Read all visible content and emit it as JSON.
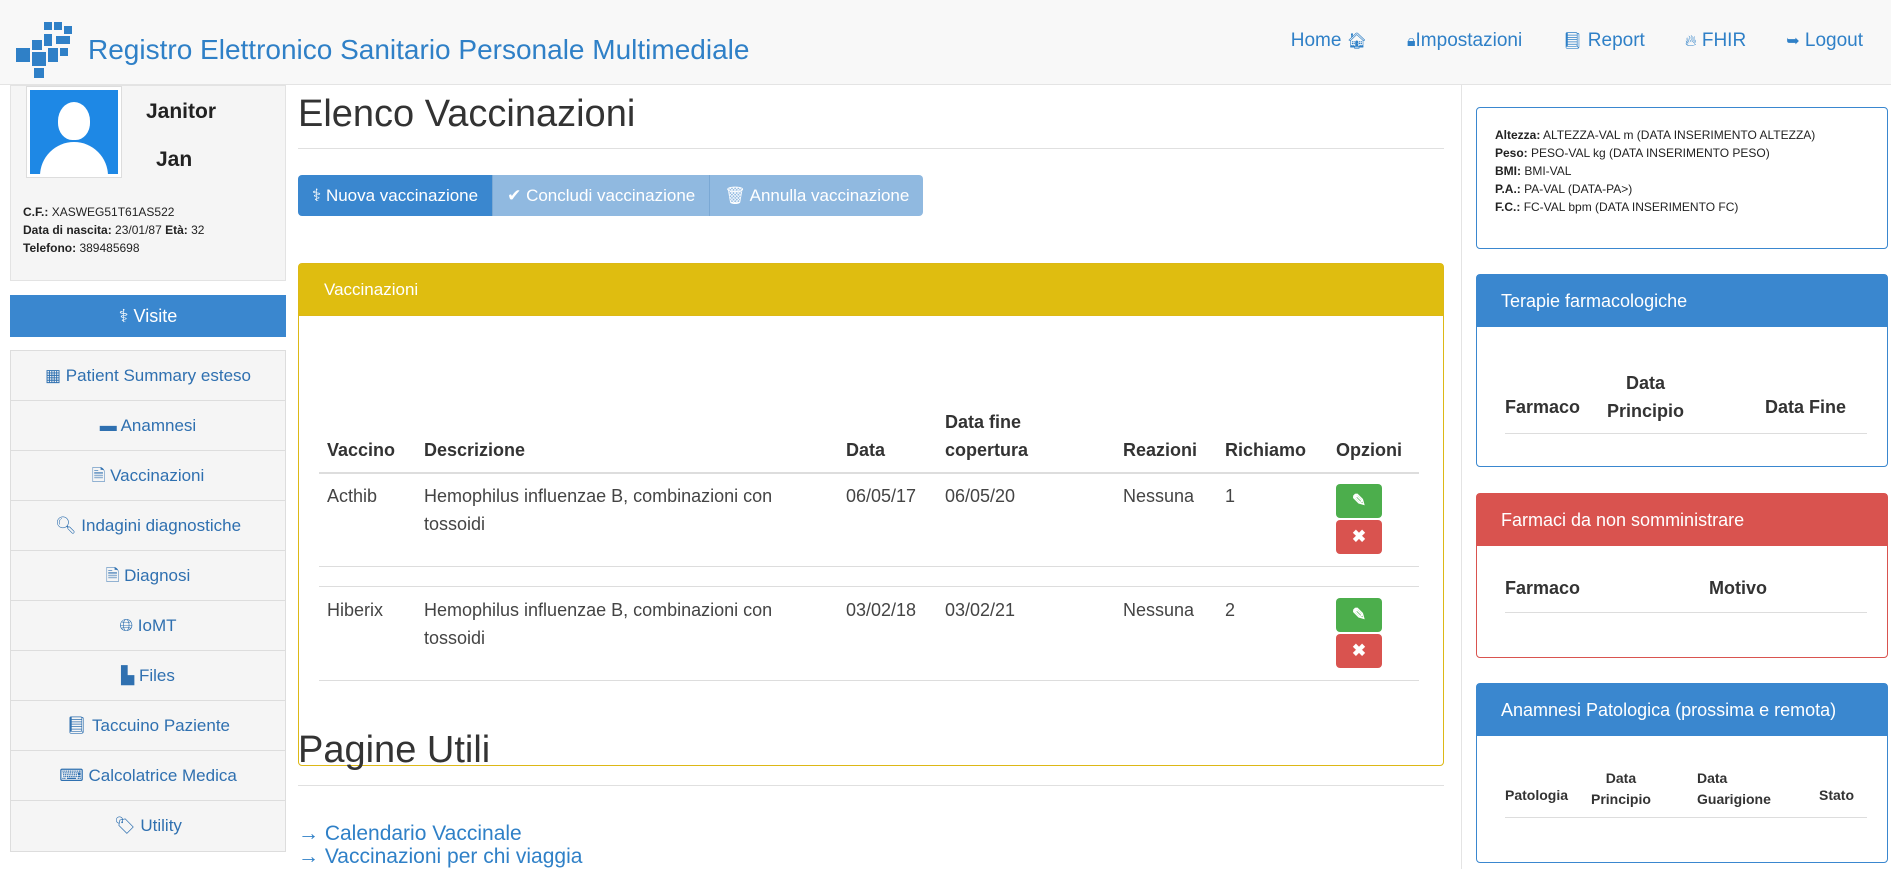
{
  "header": {
    "title": "Registro Elettronico Sanitario Personale Multimediale",
    "nav": [
      {
        "label": "Home",
        "icon": "home-icon",
        "glyph": "🏠︎"
      },
      {
        "label": "Impostazioni",
        "icon": "lock-icon",
        "glyph": "🔒︎"
      },
      {
        "label": "Report",
        "icon": "book-icon",
        "glyph": "📘︎"
      },
      {
        "label": "FHIR",
        "icon": "fire-icon",
        "glyph": "🔥︎"
      },
      {
        "label": "Logout",
        "icon": "logout-icon",
        "glyph": "➥"
      }
    ]
  },
  "patient": {
    "first_name": "Janitor",
    "last_name": "Jan",
    "cf_label": "C.F.:",
    "cf": "XASWEG51T61AS522",
    "dob_label": "Data di nascita:",
    "dob": "23/01/87",
    "age_label": "Età:",
    "age": "32",
    "phone_label": "Telefono:",
    "phone": "389485698"
  },
  "sidebar": {
    "visite_label": "Visite",
    "items": [
      {
        "label": "Patient Summary esteso",
        "glyph": "▦"
      },
      {
        "label": "Anamnesi",
        "glyph": "▬"
      },
      {
        "label": "Vaccinazioni",
        "glyph": "🗎"
      },
      {
        "label": "Indagini diagnostiche",
        "glyph": "🔍︎"
      },
      {
        "label": "Diagnosi",
        "glyph": "🗎"
      },
      {
        "label": "IoMT",
        "glyph": "🌐︎"
      },
      {
        "label": "Files",
        "glyph": "▙"
      },
      {
        "label": "Taccuino Paziente",
        "glyph": "📘︎"
      },
      {
        "label": "Calcolatrice Medica",
        "glyph": "⌨"
      },
      {
        "label": "Utility",
        "glyph": "🏷︎"
      }
    ]
  },
  "main": {
    "title": "Elenco Vaccinazioni",
    "buttons": {
      "new": "Nuova vaccinazione",
      "conclude": "Concludi vaccinazione",
      "cancel": "Annulla vaccinazione"
    },
    "panel_title": "Vaccinazioni",
    "columns": {
      "vaccino": "Vaccino",
      "descrizione": "Descrizione",
      "data": "Data",
      "data_fine_1": "Data fine",
      "data_fine_2": "copertura",
      "reazioni": "Reazioni",
      "richiamo": "Richiamo",
      "opzioni": "Opzioni"
    },
    "rows": [
      {
        "vaccino": "Acthib",
        "desc_1": "Hemophilus influenzae B, combinazioni con",
        "desc_2": "tossoidi",
        "data": "06/05/17",
        "data_fine": "06/05/20",
        "reazioni": "Nessuna",
        "richiamo": "1"
      },
      {
        "vaccino": "Hiberix",
        "desc_1": "Hemophilus influenzae B, combinazioni con",
        "desc_2": "tossoidi",
        "data": "03/02/18",
        "data_fine": "03/02/21",
        "reazioni": "Nessuna",
        "richiamo": "2"
      }
    ],
    "useful_title": "Pagine Utili",
    "links": [
      "→ Calendario Vaccinale",
      "→ Vaccinazioni per chi viaggia"
    ]
  },
  "vitals": {
    "altezza_label": "Altezza:",
    "altezza": "ALTEZZA-VAL m (DATA INSERIMENTO ALTEZZA)",
    "peso_label": "Peso:",
    "peso": "PESO-VAL kg (DATA INSERIMENTO PESO)",
    "bmi_label": "BMI:",
    "bmi": "BMI-VAL",
    "pa_label": "P.A.:",
    "pa": "PA-VAL (DATA-PA>)",
    "fc_label": "F.C.:",
    "fc": "FC-VAL bpm (DATA INSERIMENTO FC)"
  },
  "terapie": {
    "title": "Terapie farmacologiche",
    "farmaco": "Farmaco",
    "data_principio_1": "Data",
    "data_principio_2": "Principio",
    "data_fine": "Data Fine"
  },
  "non_somministrare": {
    "title": "Farmaci da non somministrare",
    "farmaco": "Farmaco",
    "motivo": "Motivo"
  },
  "anamnesi_pat": {
    "title": "Anamnesi Patologica (prossima e remota)",
    "patologia": "Patologia",
    "data_principio_1": "Data",
    "data_principio_2": "Principio",
    "data_guarigione_1": "Data",
    "data_guarigione_2": "Guarigione",
    "stato": "Stato"
  },
  "colors": {
    "primary": "#3a87cf",
    "warning": "#dfbd10",
    "danger": "#d9534f",
    "success": "#4cae4c"
  }
}
